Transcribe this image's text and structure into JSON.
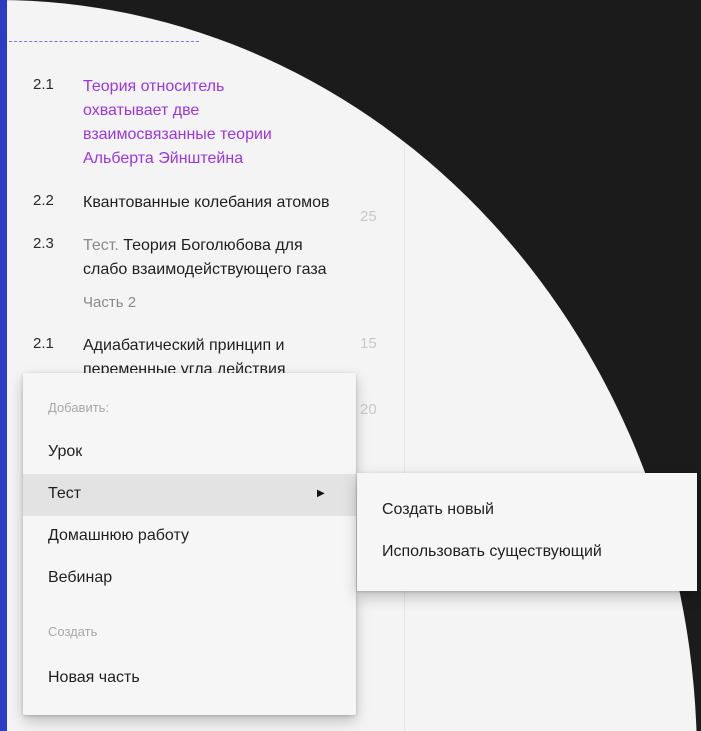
{
  "outline": {
    "items": [
      {
        "num": "2.1",
        "lines": [
          "Теория относитель",
          "охватывает две",
          "взаимосвязанные теории",
          "Альберта Эйнштейна"
        ]
      },
      {
        "num": "2.2",
        "title": "Квантованные колебания атомов",
        "time": "25"
      },
      {
        "num": "2.3",
        "prefix": "Тест.",
        "title_rest": " Теория Боголюбова для",
        "line2": "слабо взаимодействующего газа"
      },
      {
        "part_label": "Часть 2"
      },
      {
        "num": "2.1",
        "lines": [
          "Адиабатический принцип и",
          "переменные угла действия"
        ],
        "time": "15"
      },
      {
        "time": "20"
      }
    ]
  },
  "context_menu": {
    "header_add": "Добавить:",
    "item_lesson": "Урок",
    "item_test": "Тест",
    "item_homework": "Домашнюю работу",
    "item_webinar": "Вебинар",
    "header_create": "Создать",
    "item_new_part": "Новая часть"
  },
  "submenu": {
    "create_new": "Создать новый",
    "use_existing": "Использовать существующий"
  },
  "colors": {
    "accent_purple": "#9b35e0",
    "sidebar_blue": "#2a3cc4"
  }
}
